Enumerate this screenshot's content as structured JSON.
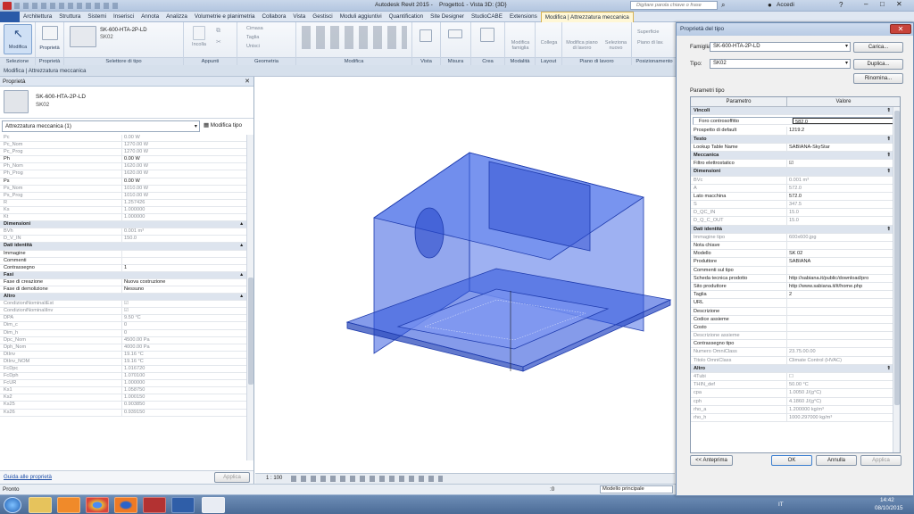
{
  "app": {
    "title": "Autodesk Revit 2015 -",
    "doc": "Progetto1 - Vista 3D: {3D}",
    "search_placeholder": "Digitare parola chiave o frase",
    "user": "Accedi"
  },
  "tabs": [
    "Architettura",
    "Struttura",
    "Sistemi",
    "Inserisci",
    "Annota",
    "Analizza",
    "Volumetrie e planimetria",
    "Collabora",
    "Vista",
    "Gestisci",
    "Moduli aggiuntivi",
    "Quantification",
    "Site Designer",
    "StudioCABE",
    "Extensions",
    "Modifica | Attrezzatura meccanica"
  ],
  "ribbon": {
    "panels": [
      "Selezione",
      "Proprietà",
      "Selettore di tipo",
      "Appunti",
      "Geometria",
      "Modifica",
      "Vista",
      "Misura",
      "Crea",
      "Modalità",
      "Layout",
      "Piano di lavoro",
      "Posizionamento"
    ],
    "modifica": "Modifica",
    "proprieta": "Proprietà",
    "type_name": "SK-600-HTA-2P-LD",
    "type_sub": "SK02",
    "incolla": "Incolla",
    "taglia": "Taglia",
    "unisci": "Unisci",
    "cimasa": "Cimasa",
    "modifica_famiglia": "Modifica famiglia",
    "collega": "Collega",
    "modifica_piano": "Modifica piano di lavoro",
    "seleziona_nuovo": "Seleziona nuovo",
    "superficie": "Superficie",
    "piano_lavoro": "Piano di lav."
  },
  "infobar": "Modifica | Attrezzatura meccanica",
  "props": {
    "header": "Proprietà",
    "type_name": "SK-600-HTA-2P-LD",
    "type_sub": "SK02",
    "selector": "Attrezzatura meccanica (1)",
    "edit_type": "Modifica tipo",
    "rows": [
      {
        "k": "Pc",
        "v": "0.00 W",
        "g": true
      },
      {
        "k": "Pc_Nom",
        "v": "1270.00 W",
        "g": true
      },
      {
        "k": "Pc_Prog",
        "v": "1270.00 W",
        "g": true
      },
      {
        "k": "Ph",
        "v": "0.00 W"
      },
      {
        "k": "Ph_Nom",
        "v": "1620.00 W",
        "g": true
      },
      {
        "k": "Ph_Prog",
        "v": "1620.00 W",
        "g": true
      },
      {
        "k": "Ps",
        "v": "0.00 W"
      },
      {
        "k": "Ps_Nom",
        "v": "1010.00 W",
        "g": true
      },
      {
        "k": "Ps_Prog",
        "v": "1010.00 W",
        "g": true
      },
      {
        "k": "R",
        "v": "1.257426",
        "g": true
      },
      {
        "k": "Ks",
        "v": "1.000000",
        "g": true
      },
      {
        "k": "Kt",
        "v": "1.000000",
        "g": true
      },
      {
        "k": "Dimensioni",
        "sec": true
      },
      {
        "k": "BVh",
        "v": "0.001 m³",
        "g": true
      },
      {
        "k": "D_V_IN",
        "v": "150.0",
        "g": true
      },
      {
        "k": "Dati identità",
        "sec": true
      },
      {
        "k": "Immagine",
        "v": ""
      },
      {
        "k": "Commenti",
        "v": ""
      },
      {
        "k": "Contrassegno",
        "v": "1"
      },
      {
        "k": "Fasi",
        "sec": true
      },
      {
        "k": "Fase di creazione",
        "v": "Nuova costruzione"
      },
      {
        "k": "Fase di demolizione",
        "v": "Nessuno"
      },
      {
        "k": "Altro",
        "sec": true
      },
      {
        "k": "CondizioniNominaliEst",
        "v": "☑",
        "g": true
      },
      {
        "k": "CondizioniNominaliInv",
        "v": "☑",
        "g": true
      },
      {
        "k": "DPA",
        "v": "9.50 °C",
        "g": true
      },
      {
        "k": "Dim_c",
        "v": "0",
        "g": true
      },
      {
        "k": "Dim_h",
        "v": "0",
        "g": true
      },
      {
        "k": "Dpc_Nom",
        "v": "4500.00 Pa",
        "g": true
      },
      {
        "k": "Dph_Nom",
        "v": "4000.00 Pa",
        "g": true
      },
      {
        "k": "DtInv",
        "v": "19.16 °C",
        "g": true
      },
      {
        "k": "DtInv_NOM",
        "v": "19.16 °C",
        "g": true
      },
      {
        "k": "FcDpc",
        "v": "1.016720",
        "g": true
      },
      {
        "k": "FcDph",
        "v": "1.070100",
        "g": true
      },
      {
        "k": "FcUR",
        "v": "1.000000",
        "g": true
      },
      {
        "k": "Ks1",
        "v": "1.058750",
        "g": true
      },
      {
        "k": "Ks2",
        "v": "1.000150",
        "g": true
      },
      {
        "k": "Ks25",
        "v": "0.903850",
        "g": true
      },
      {
        "k": "Ks26",
        "v": "0.939150",
        "g": true
      }
    ],
    "help_link": "Guida alle proprietà",
    "apply": "Applica"
  },
  "viewbar": {
    "scale": "1 : 100"
  },
  "status": {
    "text": "Pronto",
    "model": "Modello principale",
    "filter": ":0"
  },
  "tray": {
    "lang": "IT",
    "time": "14:42",
    "date": "08/10/2015"
  },
  "dialog": {
    "title": "Proprietà del tipo",
    "famiglia_label": "Famiglia:",
    "famiglia_value": "SK-600-HTA-2P-LD",
    "carica": "Carica...",
    "tipo_label": "Tipo:",
    "tipo_value": "SK02",
    "duplica": "Duplica...",
    "rinomina": "Rinomina...",
    "param_tipo": "Parametri tipo",
    "col_param": "Parametro",
    "col_valore": "Valore",
    "rows": [
      {
        "k": "Vincoli",
        "sec": true
      },
      {
        "k": "Foro controsoffitto",
        "v": "582.0",
        "sel": true
      },
      {
        "k": "Prospetto di default",
        "v": "1219.2"
      },
      {
        "k": "Testo",
        "sec": true
      },
      {
        "k": "Lookup Table Name",
        "v": "SABIANA-SkyStar"
      },
      {
        "k": "Meccanica",
        "sec": true
      },
      {
        "k": "Filtro elettrostatico",
        "v": "☑"
      },
      {
        "k": "Dimensioni",
        "sec": true
      },
      {
        "k": "BVc",
        "v": "0.001 m³",
        "g": true
      },
      {
        "k": "A",
        "v": "572.0",
        "g": true
      },
      {
        "k": "Lato macchina",
        "v": "572.0"
      },
      {
        "k": "S",
        "v": "347.5",
        "g": true
      },
      {
        "k": "D_QC_IN",
        "v": "15.0",
        "g": true
      },
      {
        "k": "D_Q_C_OUT",
        "v": "15.0",
        "g": true
      },
      {
        "k": "Dati identità",
        "sec": true
      },
      {
        "k": "Immagine tipo",
        "v": "600x600.jpg",
        "g": true
      },
      {
        "k": "Nota chiave",
        "v": ""
      },
      {
        "k": "Modello",
        "v": "SK 02"
      },
      {
        "k": "Produttore",
        "v": "SABIANA"
      },
      {
        "k": "Commenti sul tipo",
        "v": ""
      },
      {
        "k": "Scheda tecnica prodotto",
        "v": "http://sabiana.it/public/download/pro"
      },
      {
        "k": "Sito produttore",
        "v": "http://www.sabiana.it/it/home.php"
      },
      {
        "k": "Taglia",
        "v": "2"
      },
      {
        "k": "URL",
        "v": ""
      },
      {
        "k": "Descrizione",
        "v": ""
      },
      {
        "k": "Codice assieme",
        "v": ""
      },
      {
        "k": "Costo",
        "v": ""
      },
      {
        "k": "Descrizione assieme",
        "v": "",
        "g": true
      },
      {
        "k": "Contrassegno tipo",
        "v": ""
      },
      {
        "k": "Numero OmniClass",
        "v": "23.75.00.00",
        "g": true
      },
      {
        "k": "Titolo OmniClass",
        "v": "Climate Control (HVAC)",
        "g": true
      },
      {
        "k": "Altro",
        "sec": true
      },
      {
        "k": "4Tubi",
        "v": "☐",
        "g": true
      },
      {
        "k": "THIN_def",
        "v": "50.00 °C",
        "g": true
      },
      {
        "k": "cpa",
        "v": "1.0050 J/(g°C)",
        "g": true
      },
      {
        "k": "cph",
        "v": "4.1860 J/(g°C)",
        "g": true
      },
      {
        "k": "rho_a",
        "v": "1.200000 kg/m³",
        "g": true
      },
      {
        "k": "rho_h",
        "v": "1000.297000 kg/m³",
        "g": true
      }
    ],
    "anteprima": "<< Anteprima",
    "ok": "OK",
    "annulla": "Annulla",
    "applica": "Applica"
  }
}
